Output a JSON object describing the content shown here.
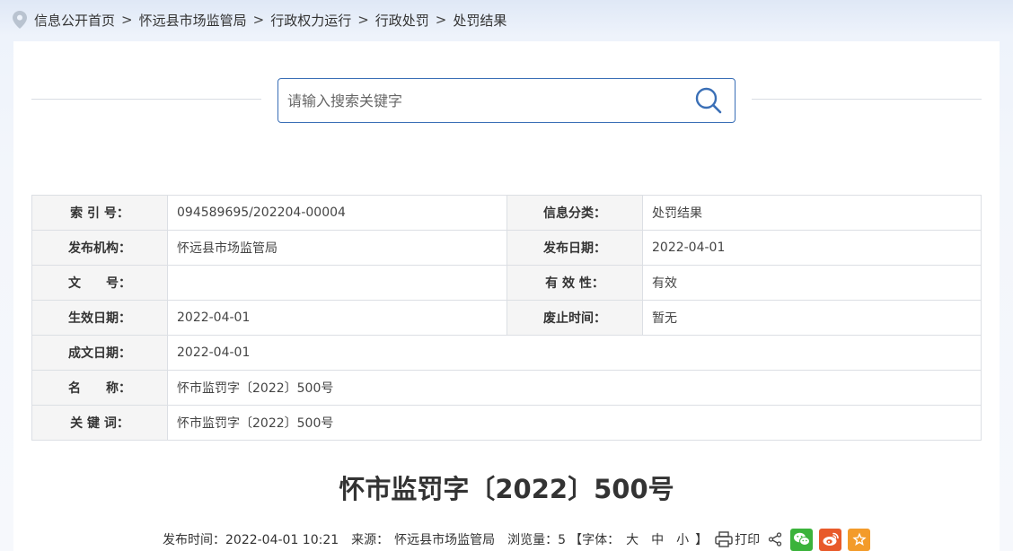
{
  "breadcrumb": {
    "items": [
      "信息公开首页",
      "怀远县市场监管局",
      "行政权力运行",
      "行政处罚",
      "处罚结果"
    ],
    "separator": ">"
  },
  "search": {
    "placeholder": "请输入搜索关键字",
    "value": ""
  },
  "meta": {
    "index_label": "索 引 号：",
    "index_value": "094589695/202204-00004",
    "category_label": "信息分类：",
    "category_value": "处罚结果",
    "publisher_label": "发布机构：",
    "publisher_value": "怀远县市场监管局",
    "publish_date_label": "发布日期：",
    "publish_date_value": "2022-04-01",
    "doc_no_label": "文　　号：",
    "doc_no_value": "",
    "validity_label": "有 效 性：",
    "validity_value": "有效",
    "effective_label": "生效日期：",
    "effective_value": "2022-04-01",
    "abolish_label": "废止时间：",
    "abolish_value": "暂无",
    "written_label": "成文日期：",
    "written_value": "2022-04-01",
    "name_label": "名　　称：",
    "name_value": "怀市监罚字〔2022〕500号",
    "keywords_label": "关 键 词：",
    "keywords_value": "怀市监罚字〔2022〕500号"
  },
  "article": {
    "title": "怀市监罚字〔2022〕500号"
  },
  "info": {
    "publish_time": "发布时间：2022-04-01 10:21",
    "source_label": "来源：",
    "source_value": "怀远县市场监管局",
    "views": "浏览量：5",
    "font_open": "【字体：",
    "font_large": "大",
    "font_medium": "中",
    "font_small": "小",
    "font_close": "】",
    "print": "打印"
  },
  "colors": {
    "accent": "#3a6fb6",
    "wechat": "#3bb33b",
    "weibo": "#e85a2a",
    "favorite": "#f39b2a"
  }
}
